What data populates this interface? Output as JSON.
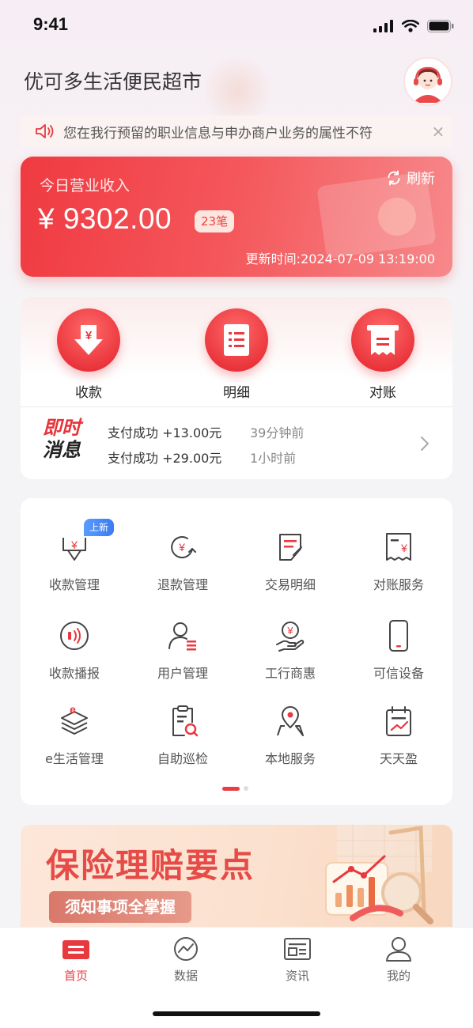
{
  "status_bar": {
    "time": "9:41"
  },
  "header": {
    "store_name": "优可多生活便民超市"
  },
  "notice": {
    "text": "您在我行预留的职业信息与申办商户业务的属性不符",
    "close": "×"
  },
  "revenue": {
    "label": "今日营业收入",
    "refresh_label": "刷新",
    "amount": "¥ 9302.00",
    "count": "23笔",
    "update_time": "更新时间:2024-07-09 13:19:00"
  },
  "quick_actions": [
    {
      "label": "收款",
      "icon": "receive-money-icon"
    },
    {
      "label": "明细",
      "icon": "details-list-icon"
    },
    {
      "label": "对账",
      "icon": "reconcile-receipt-icon"
    }
  ],
  "instant_messages": {
    "logo_line1": "即时",
    "logo_line2": "消息",
    "items": [
      {
        "text": "支付成功 +13.00元",
        "when": "39分钟前"
      },
      {
        "text": "支付成功 +29.00元",
        "when": "1小时前"
      }
    ]
  },
  "services": [
    {
      "label": "收款管理",
      "icon": "collection-management-icon",
      "badge": "上新"
    },
    {
      "label": "退款管理",
      "icon": "refund-management-icon"
    },
    {
      "label": "交易明细",
      "icon": "transaction-details-icon"
    },
    {
      "label": "对账服务",
      "icon": "reconciliation-service-icon"
    },
    {
      "label": "收款播报",
      "icon": "payment-broadcast-icon"
    },
    {
      "label": "用户管理",
      "icon": "user-management-icon"
    },
    {
      "label": "工行商惠",
      "icon": "icbc-merchant-benefit-icon"
    },
    {
      "label": "可信设备",
      "icon": "trusted-device-icon"
    },
    {
      "label": "e生活管理",
      "icon": "e-life-management-icon"
    },
    {
      "label": "自助巡检",
      "icon": "self-inspection-icon"
    },
    {
      "label": "本地服务",
      "icon": "local-service-icon"
    },
    {
      "label": "天天盈",
      "icon": "daily-profit-icon"
    }
  ],
  "pager": {
    "pages": 2,
    "current": 1
  },
  "banner": {
    "title": "保险理赔要点",
    "subtitle": "须知事项全掌握"
  },
  "tabbar": [
    {
      "label": "首页",
      "icon": "home-icon",
      "active": true
    },
    {
      "label": "数据",
      "icon": "data-chart-icon",
      "active": false
    },
    {
      "label": "资讯",
      "icon": "news-icon",
      "active": false
    },
    {
      "label": "我的",
      "icon": "profile-icon",
      "active": false
    }
  ],
  "colors": {
    "brand_red": "#e8393f",
    "new_badge": "#3a7bf0"
  }
}
